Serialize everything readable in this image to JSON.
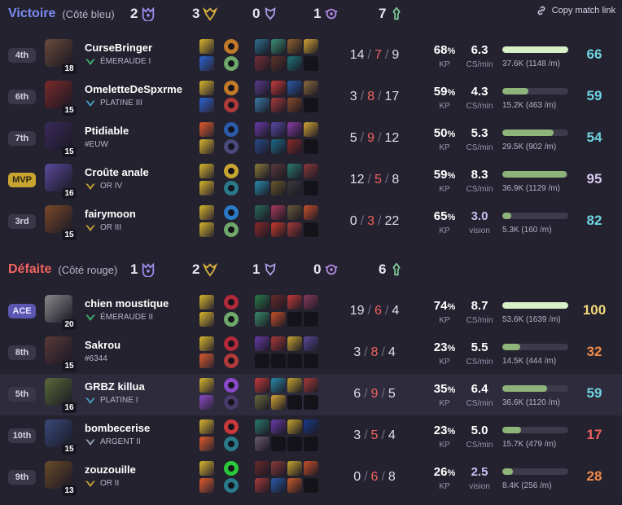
{
  "copy_link_label": "Copy match link",
  "teams": [
    {
      "result": "Victoire",
      "side": "(Côté bleu)",
      "result_color": "#7b8cf5",
      "objectives": {
        "barons": "2",
        "dragons": "3",
        "heralds": "0",
        "voidgrubs": "1",
        "towers": "7"
      },
      "players": [
        {
          "rank_label": "4th",
          "level": "18",
          "name": "CurseBringer",
          "tier": "ÉMERAUDE I",
          "tier_color": "#3fb36d",
          "kills": "14",
          "deaths": "7",
          "assists": "9",
          "kp": "68",
          "cs": "6.3",
          "cs_label": "CS/min",
          "dmg": "37.6K (1148 /m)",
          "dmg_frac": 1.0,
          "score": "66",
          "score_color": "#6fd3e0",
          "avatar": "#6a4a3a",
          "spells": [
            "#d8b62b",
            "#2a64d4"
          ],
          "runes": [
            "#c27a2a",
            "#6ea86a"
          ],
          "items": [
            "#2c6e8e",
            "#3a8f74",
            "#8e6230",
            "#d2a536",
            "#7a2f3a",
            "#5f3428",
            "#1e7478",
            null
          ]
        },
        {
          "rank_label": "6th",
          "level": "15",
          "name": "OmeletteDeSpxrme",
          "tier": "PLATINE III",
          "tier_color": "#4aa0c8",
          "kills": "3",
          "deaths": "8",
          "assists": "17",
          "kp": "59",
          "cs": "4.3",
          "cs_label": "CS/min",
          "dmg": "15.2K (463 /m)",
          "dmg_frac": 0.4,
          "score": "59",
          "score_color": "#6fd3e0",
          "avatar": "#7a2a2a",
          "spells": [
            "#d8b62b",
            "#2a64d4"
          ],
          "runes": [
            "#c27a2a",
            "#b03a3a"
          ],
          "items": [
            "#5a3a8a",
            "#c83a3a",
            "#2a5aa8",
            "#8a6a3a",
            "#3a7aa8",
            "#a83a3a",
            "#8a4a2a",
            null
          ]
        },
        {
          "rank_label": "7th",
          "level": "15",
          "name": "Ptidiable",
          "tier": "#EUW",
          "tier_color": "",
          "kills": "5",
          "deaths": "9",
          "assists": "12",
          "kp": "50",
          "cs": "5.3",
          "cs_label": "CS/min",
          "dmg": "29.5K (902 /m)",
          "dmg_frac": 0.78,
          "score": "54",
          "score_color": "#6fd3e0",
          "avatar": "#3a2a5a",
          "spells": [
            "#e05a2a",
            "#d8b62b"
          ],
          "runes": [
            "#2a5aa8",
            "#4a4a7a"
          ],
          "items": [
            "#6a3aa8",
            "#5a4aa8",
            "#8a3aa8",
            "#d2a536",
            "#2a4a8a",
            "#1e6a8a",
            "#8a2a2a",
            null
          ]
        },
        {
          "rank_label": "MVP",
          "level": "16",
          "name": "Croûte anale",
          "tier": "OR IV",
          "tier_color": "#c8a531",
          "kills": "12",
          "deaths": "5",
          "assists": "8",
          "kp": "59",
          "cs": "8.3",
          "cs_label": "CS/min",
          "dmg": "36.9K (1129 /m)",
          "dmg_frac": 0.98,
          "score": "95",
          "score_color": "#d8c8f0",
          "avatar": "#5a4a9a",
          "spells": [
            "#d8b62b",
            "#d8b62b"
          ],
          "runes": [
            "#c8a531",
            "#2a7a8a"
          ],
          "items": [
            "#8a7a3a",
            "#5a3a3a",
            "#2a7a6a",
            "#8a3a3a",
            "#2a8aa8",
            "#6a5a2a",
            "#3a3a3a",
            null
          ]
        },
        {
          "rank_label": "3rd",
          "level": "15",
          "name": "fairymoon",
          "tier": "OR III",
          "tier_color": "#c8a531",
          "kills": "0",
          "deaths": "3",
          "assists": "22",
          "kp": "65",
          "cs": "3.0",
          "cs_label": "vision",
          "dmg": "5.3K (160 /m)",
          "dmg_frac": 0.13,
          "score": "82",
          "score_color": "#6fd3e0",
          "avatar": "#7a4a2a",
          "spells": [
            "#d8b62b",
            "#d8b62b"
          ],
          "runes": [
            "#2a7ac8",
            "#6ea86a"
          ],
          "items": [
            "#2a6a5a",
            "#a83a5a",
            "#6a5a3a",
            "#c8502a",
            "#8a2a2a",
            "#c83a2a",
            "#a83a3a",
            null
          ]
        }
      ]
    },
    {
      "result": "Défaite",
      "side": "(Côté rouge)",
      "result_color": "#f0625f",
      "objectives": {
        "barons": "1",
        "dragons": "2",
        "heralds": "1",
        "voidgrubs": "0",
        "towers": "6"
      },
      "players": [
        {
          "rank_label": "ACE",
          "level": "20",
          "name": "chien moustique",
          "tier": "ÉMERAUDE II",
          "tier_color": "#3fb36d",
          "kills": "19",
          "deaths": "6",
          "assists": "4",
          "kp": "74",
          "cs": "8.7",
          "cs_label": "CS/min",
          "dmg": "53.6K (1639 /m)",
          "dmg_frac": 1.0,
          "score": "100",
          "score_color": "#f0d87a",
          "avatar": "#8a8a8a",
          "spells": [
            "#d8b62b",
            "#d8b62b"
          ],
          "runes": [
            "#b02a3a",
            "#6ea86a"
          ],
          "items": [
            "#2a7a4a",
            "#6a2a2a",
            "#c83a3a",
            "#8a3a5a",
            "#3a8a6a",
            "#c8502a",
            null,
            null
          ]
        },
        {
          "rank_label": "8th",
          "level": "15",
          "name": "Sakrou",
          "tier": "#6344",
          "tier_color": "",
          "kills": "3",
          "deaths": "8",
          "assists": "4",
          "kp": "23",
          "cs": "5.5",
          "cs_label": "CS/min",
          "dmg": "14.5K (444 /m)",
          "dmg_frac": 0.27,
          "score": "32",
          "score_color": "#f08a4a",
          "avatar": "#5a3a3a",
          "spells": [
            "#d8b62b",
            "#e05a2a"
          ],
          "runes": [
            "#b02a3a",
            "#b03a3a"
          ],
          "items": [
            "#6a3aa8",
            "#a83a3a",
            "#c8a531",
            "#5a4a9a",
            null,
            null,
            null,
            null
          ]
        },
        {
          "rank_label": "5th",
          "level": "16",
          "name": "GRBZ killua",
          "tier": "PLATINE I",
          "tier_color": "#4aa0c8",
          "kills": "6",
          "deaths": "9",
          "assists": "5",
          "kp": "35",
          "cs": "6.4",
          "cs_label": "CS/min",
          "dmg": "36.6K (1120 /m)",
          "dmg_frac": 0.68,
          "score": "59",
          "score_color": "#6fd3e0",
          "avatar": "#5a6a3a",
          "spells": [
            "#d8b62b",
            "#8a4ac8"
          ],
          "runes": [
            "#8a4ac8",
            "#4a3a6a"
          ],
          "items": [
            "#c83a3a",
            "#2a8aa8",
            "#c8a531",
            "#a83a3a",
            "#6a6a3a",
            "#d2a536",
            null,
            null
          ]
        },
        {
          "rank_label": "10th",
          "level": "15",
          "name": "bombecerise",
          "tier": "ARGENT II",
          "tier_color": "#9aa8b8",
          "kills": "3",
          "deaths": "5",
          "assists": "4",
          "kp": "23",
          "cs": "5.0",
          "cs_label": "CS/min",
          "dmg": "15.7K (479 /m)",
          "dmg_frac": 0.29,
          "score": "17",
          "score_color": "#f0625f",
          "avatar": "#3a4a7a",
          "spells": [
            "#d8b62b",
            "#e05a2a"
          ],
          "runes": [
            "#c83a3a",
            "#2a7a8a"
          ],
          "items": [
            "#2a7a6a",
            "#6a3aa8",
            "#c8a531",
            "#1a3a8a",
            "#6a5a6a",
            null,
            null,
            null
          ]
        },
        {
          "rank_label": "9th",
          "level": "13",
          "name": "zouzouille",
          "tier": "OR II",
          "tier_color": "#c8a531",
          "kills": "0",
          "deaths": "6",
          "assists": "8",
          "kp": "26",
          "cs": "2.5",
          "cs_label": "vision",
          "dmg": "8.4K (256 /m)",
          "dmg_frac": 0.16,
          "score": "28",
          "score_color": "#f08a4a",
          "avatar": "#6a4a2a",
          "spells": [
            "#d8b62b",
            "#e05a2a"
          ],
          "runes": [
            "#2ac83a",
            "#2a7a8a"
          ],
          "items": [
            "#6a2a2a",
            "#8a3a3a",
            "#c8a531",
            "#c8502a",
            "#a83a3a",
            "#2a5aa8",
            "#c85a2a",
            null
          ]
        }
      ]
    }
  ],
  "labels": {
    "kp": "KP",
    "pct": "%"
  },
  "colors": {
    "background": "#24222f",
    "highlight_row": "#2e2b3c",
    "deaths": "#f0625f",
    "bar_fill": "#8fb47a",
    "bar_top": "#d8f0c8"
  }
}
